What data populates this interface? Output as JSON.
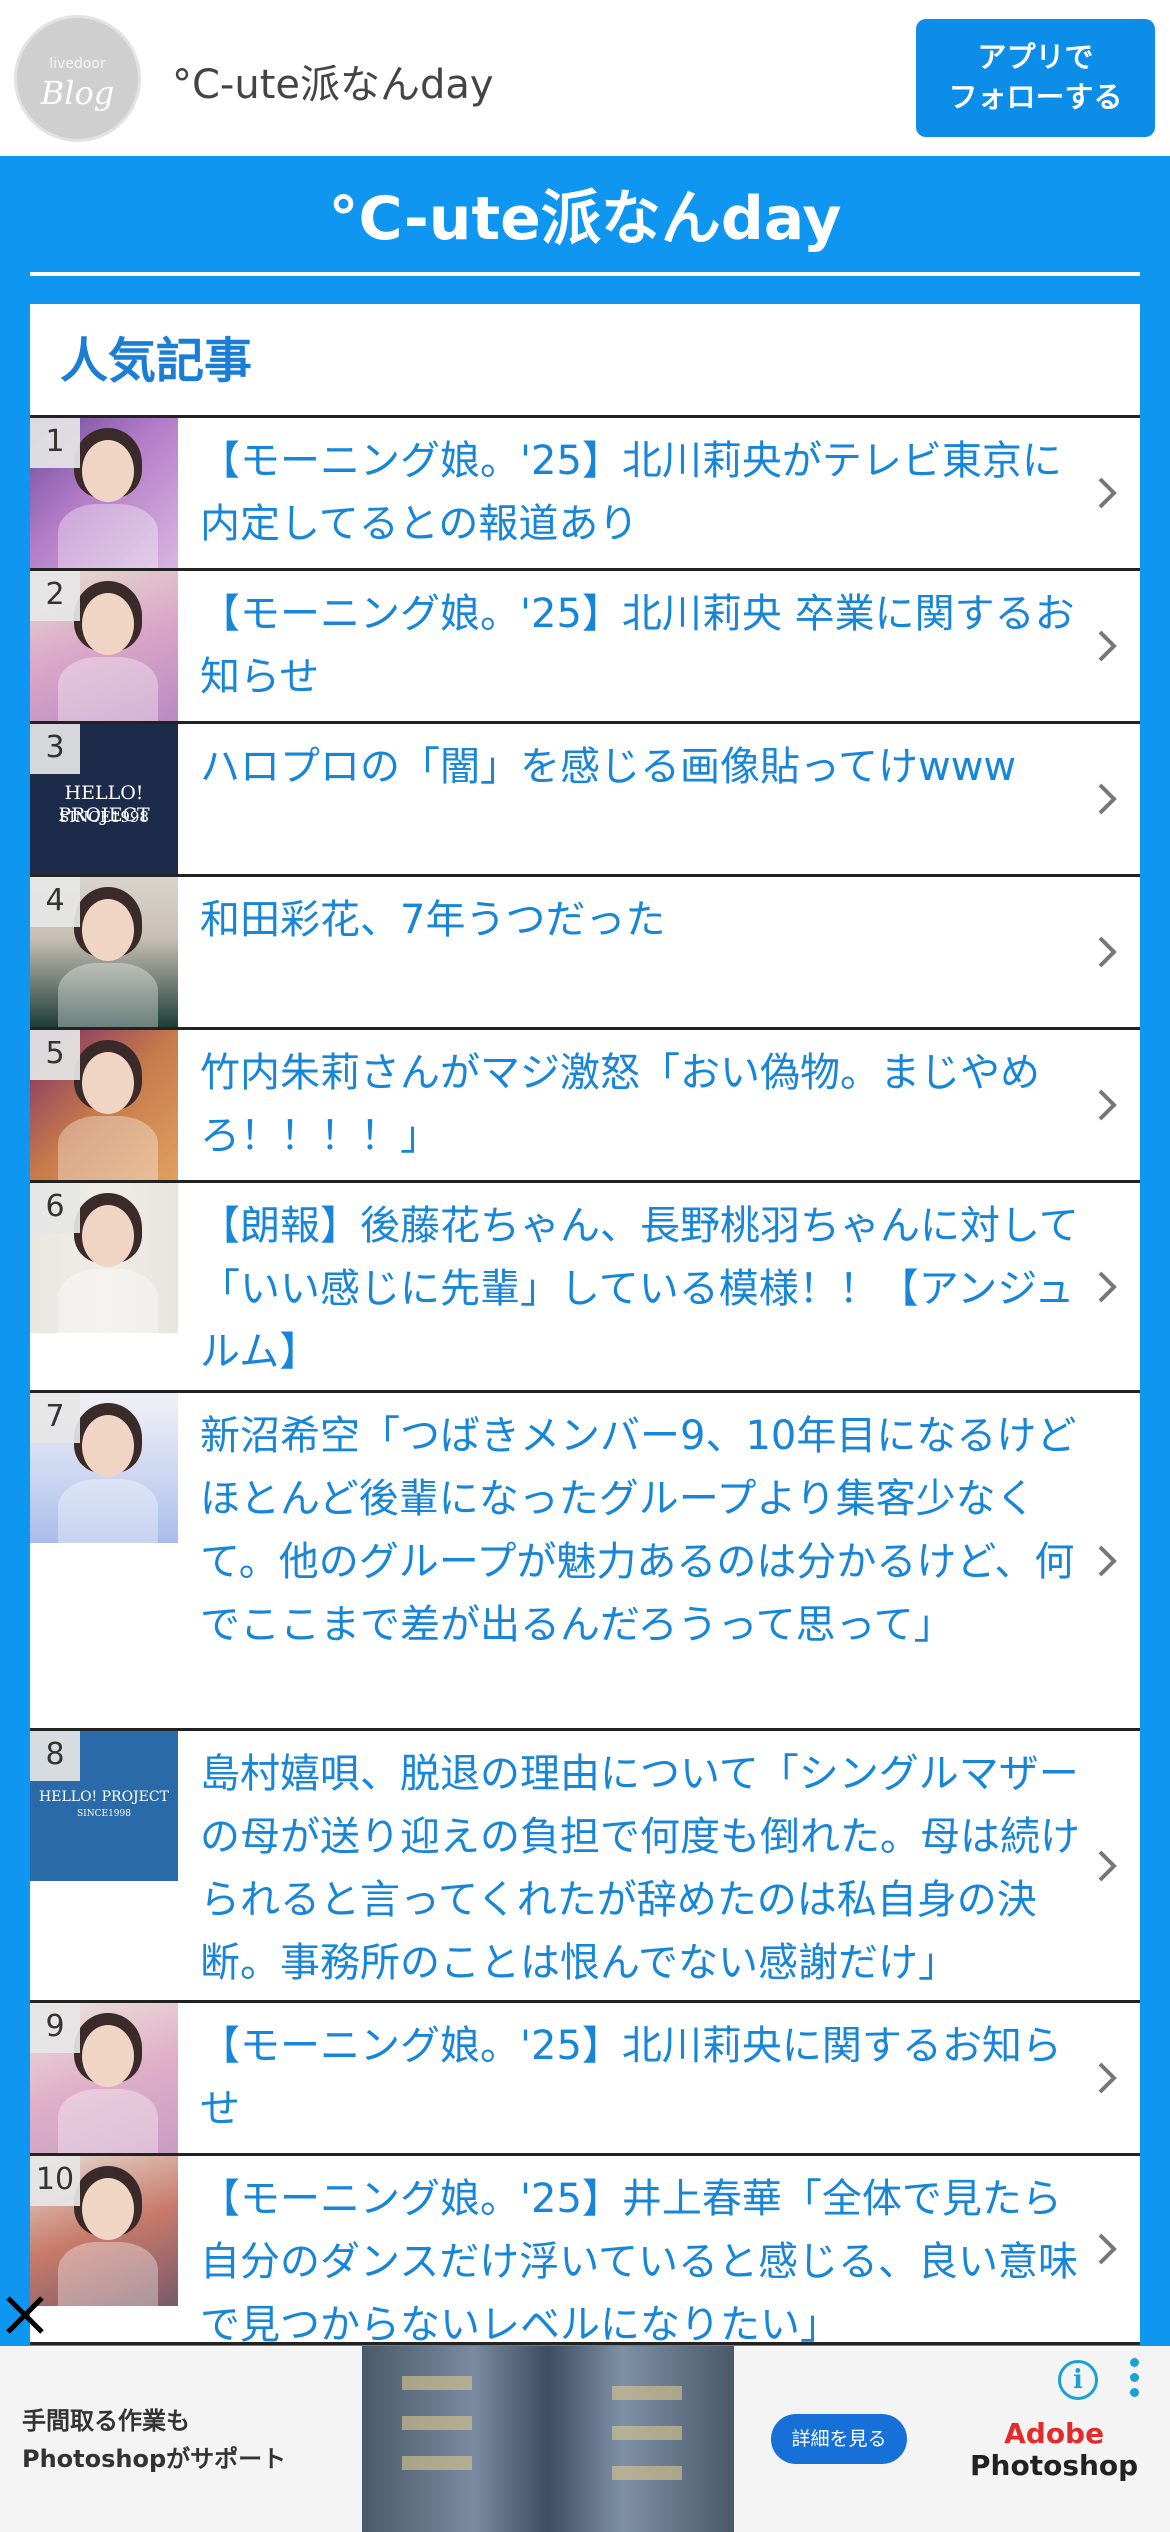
{
  "header": {
    "logo_small": "livedoor",
    "logo_big": "Blog",
    "blog_name": "°C-ute派なんday",
    "follow_line1": "アプリで",
    "follow_line2": "フォローする"
  },
  "page": {
    "title": "°C-ute派なんday",
    "ranking_heading": "人気記事"
  },
  "articles": [
    {
      "rank": "1",
      "title": "【モーニング娘。'25】北川莉央がテレビ東京に内定してるとの報道あり"
    },
    {
      "rank": "2",
      "title": "【モーニング娘。'25】北川莉央 卒業に関するお知らせ"
    },
    {
      "rank": "3",
      "title": "ハロプロの「闇」を感じる画像貼ってけwww",
      "thumb_text": "HELLO! PROJECT",
      "thumb_sub": "SINCE1998"
    },
    {
      "rank": "4",
      "title": "和田彩花、7年うつだった"
    },
    {
      "rank": "5",
      "title": "竹内朱莉さんがマジ激怒「おい偽物。まじやめろ！！！！」"
    },
    {
      "rank": "6",
      "title": "【朗報】後藤花ちゃん、長野桃羽ちゃんに対して「いい感じに先輩」している模様！！【アンジュルム】"
    },
    {
      "rank": "7",
      "title": "新沼希空「つばきメンバー9、10年目になるけどほとんど後輩になったグループより集客少なくて。他のグループが魅力あるのは分かるけど、何でここまで差が出るんだろうって思って」"
    },
    {
      "rank": "8",
      "title": "島村嬉唄、脱退の理由について「シングルマザーの母が送り迎えの負担で何度も倒れた。母は続けられると言ってくれたが辞めたのは私自身の決断。事務所のことは恨んでない感謝だけ」",
      "thumb_text": "HELLO! PROJECT",
      "thumb_sub": "SINCE1998"
    },
    {
      "rank": "9",
      "title": "【モーニング娘。'25】北川莉央に関するお知らせ"
    },
    {
      "rank": "10",
      "title": "【モーニング娘。'25】井上春華「全体で見たら自分のダンスだけ浮いていると感じる、良い意味で見つからないレベルになりたい」"
    }
  ],
  "ad": {
    "line1": "手間取る作業も",
    "line2": "Photoshopがサポート",
    "cta": "詳細を見る",
    "brand1": "Adobe",
    "brand2": "Photoshop",
    "info_icon": "i"
  },
  "colors": {
    "accent_blue": "#0e96f0",
    "link_blue": "#1886d8",
    "follow_button": "#0b8de8"
  }
}
